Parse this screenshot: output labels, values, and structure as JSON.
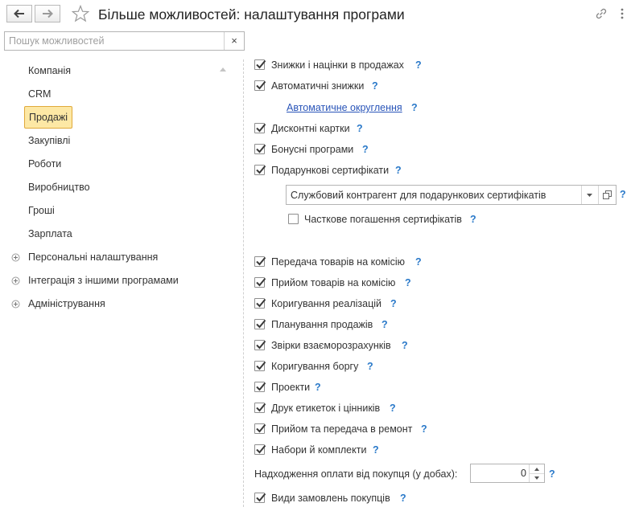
{
  "header": {
    "title": "Більше можливостей: налаштування програми"
  },
  "search": {
    "placeholder": "Пошук можливостей",
    "clear": "×"
  },
  "sidebar": {
    "items": [
      {
        "label": "Компанія"
      },
      {
        "label": "CRM"
      },
      {
        "label": "Продажі",
        "active": true
      },
      {
        "label": "Закупівлі"
      },
      {
        "label": "Роботи"
      },
      {
        "label": "Виробництво"
      },
      {
        "label": "Гроші"
      },
      {
        "label": "Зарплата"
      }
    ],
    "groups": [
      {
        "label": "Персональні налаштування"
      },
      {
        "label": "Інтеграція з іншими програмами"
      },
      {
        "label": "Адміністрування"
      }
    ]
  },
  "settings": {
    "discounts": {
      "label": "Знижки і націнки в продажах",
      "checked": true
    },
    "auto_discounts": {
      "label": "Автоматичні знижки",
      "checked": true
    },
    "auto_rounding_link": "Автоматичне округлення",
    "discount_cards": {
      "label": "Дисконтні картки",
      "checked": true
    },
    "bonus_programs": {
      "label": "Бонусні програми",
      "checked": true
    },
    "gift_certificates": {
      "label": "Подарункові сертифікати",
      "checked": true
    },
    "certificate_counterparty": {
      "value": "Службовий контрагент для подарункових сертифікатів"
    },
    "partial_redemption": {
      "label": "Часткове погашення сертифікатів",
      "checked": false
    },
    "commission_transfer": {
      "label": "Передача товарів на комісію",
      "checked": true
    },
    "commission_receipt": {
      "label": "Прийом товарів на комісію",
      "checked": true
    },
    "sales_adjustment": {
      "label": "Коригування реалізацій",
      "checked": true
    },
    "sales_planning": {
      "label": "Планування продажів",
      "checked": true
    },
    "reconciliation": {
      "label": "Звірки взаєморозрахунків",
      "checked": true
    },
    "debt_adjustment": {
      "label": "Коригування боргу",
      "checked": true
    },
    "projects": {
      "label": "Проекти",
      "checked": true
    },
    "label_printing": {
      "label": "Друк етикеток і цінників",
      "checked": true
    },
    "repair": {
      "label": "Прийом та передача в ремонт",
      "checked": true
    },
    "kits": {
      "label": "Набори й комплекти",
      "checked": true
    },
    "payment_days": {
      "label": "Надходження оплати від покупця (у добах):",
      "value": "0"
    },
    "order_types": {
      "label": "Види замовлень покупців",
      "checked": true
    }
  },
  "help_mark": "?",
  "colors": {
    "accent": "#2a79c9",
    "active_bg": "#fde8a5",
    "active_border": "#e0a93a",
    "link": "#2a55b9"
  }
}
